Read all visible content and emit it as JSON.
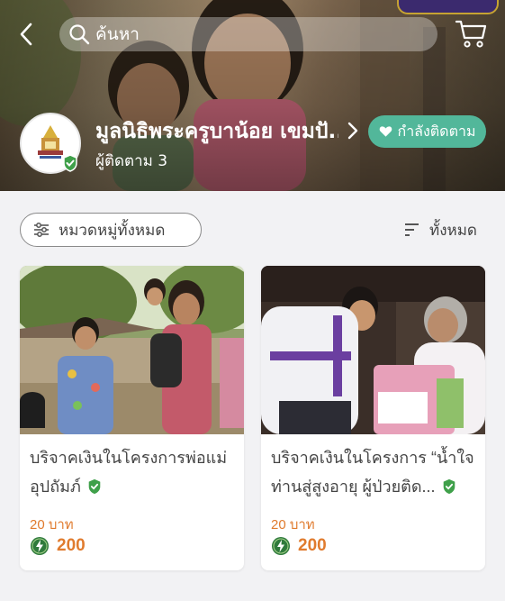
{
  "header": {
    "search_placeholder": "ค้นหา",
    "org_name": "มูลนิธิพระครูบาน้อย เขมปั...",
    "followers": "ผู้ติดตาม 3",
    "follow_label": "กำลังติดตาม"
  },
  "filters": {
    "category_label": "หมวดหมู่ทั้งหมด",
    "sort_label": "ทั้งหมด"
  },
  "campaigns": [
    {
      "title": "บริจาคเงินในโครงการพ่อแม่อุปถัมภ์",
      "price": "20 บาท",
      "points": "200"
    },
    {
      "title": "บริจาคเงินในโครงการ “น้ำใจท่านสู่สูงอายุ ผู้ป่วยติด...",
      "price": "20 บาท",
      "points": "200"
    }
  ],
  "colors": {
    "accent_green": "#52b79a",
    "price_orange": "#e07b2e",
    "verified_green": "#3fa04a"
  },
  "icons": [
    "back-icon",
    "search-icon",
    "cart-icon",
    "verified-icon",
    "chevron-right-icon",
    "heart-icon",
    "filter-sliders-icon",
    "sort-icon",
    "points-coin-icon"
  ]
}
